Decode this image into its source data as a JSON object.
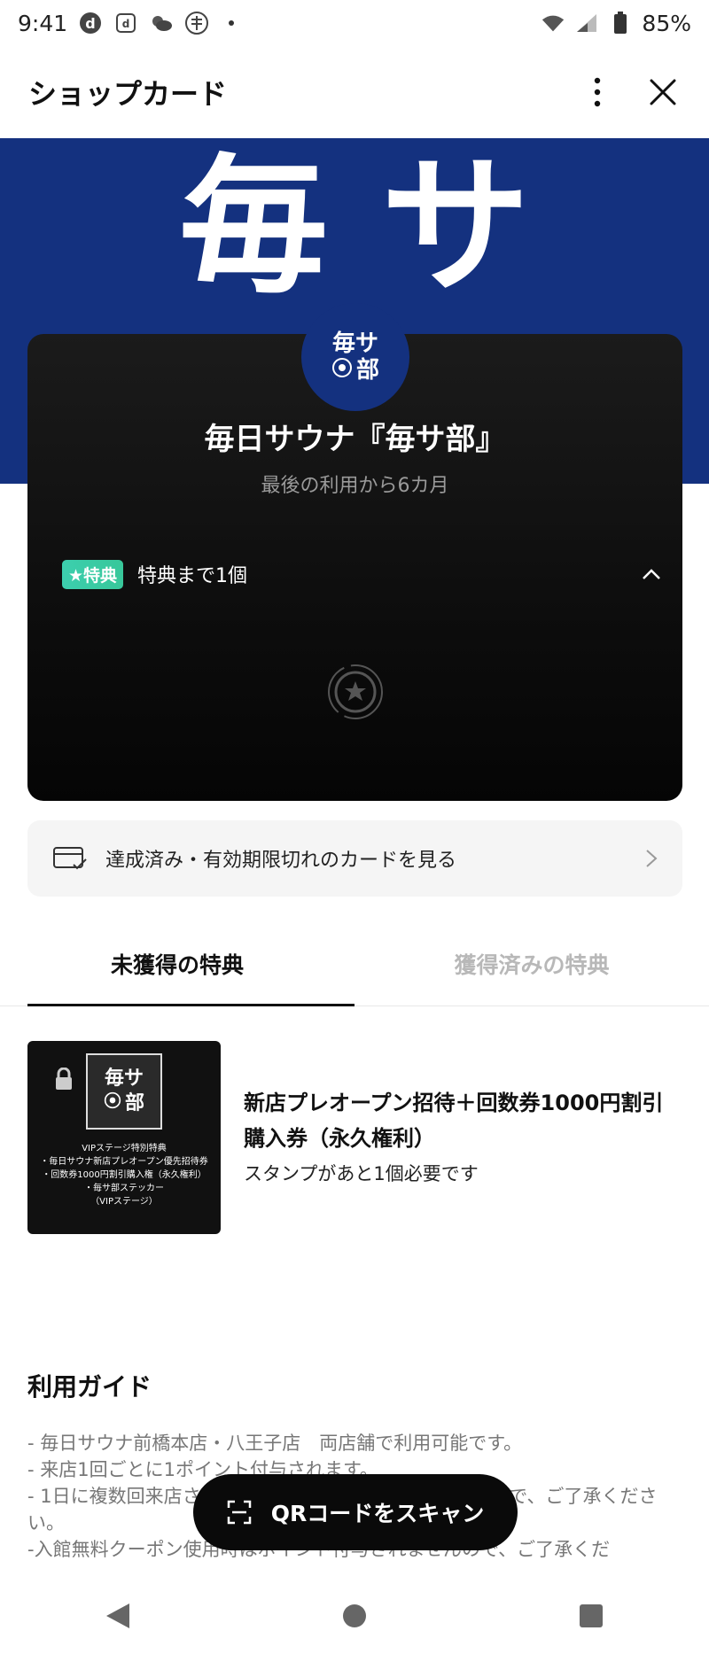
{
  "status_bar": {
    "time": "9:41",
    "battery": "85%"
  },
  "header": {
    "title": "ショップカード"
  },
  "banner": {
    "text": "毎サ"
  },
  "card": {
    "logo_top": "毎サ",
    "logo_bottom": "部",
    "title": "毎日サウナ『毎サ部』",
    "subtitle": "最後の利用から6カ月",
    "reward_badge": "★特典",
    "reward_text": "特典まで1個"
  },
  "history_link": {
    "label": "達成済み・有効期限切れのカードを見る"
  },
  "tabs": [
    {
      "label": "未獲得の特典",
      "active": true
    },
    {
      "label": "獲得済みの特典",
      "active": false
    }
  ],
  "reward_item": {
    "thumb_logo_top": "毎サ",
    "thumb_logo_bottom": "部",
    "thumb_lines": [
      "VIPステージ特別特典",
      "・毎日サウナ新店プレオープン優先招待券",
      "・回数券1000円割引購入権（永久権利）",
      "・毎サ部ステッカー",
      "（VIPステージ）"
    ],
    "title": "新店プレオープン招待＋回数券1000円割引購入券（永久権利）",
    "note": "スタンプがあと1個必要です"
  },
  "guide": {
    "title": "利用ガイド",
    "items": [
      "- 毎日サウナ前橋本店・八王子店　両店舗で利用可能です。",
      "- 来店1回ごとに1ポイント付与されます。",
      "- 1日に複数回来店されても1ポイントのみ付与されますので、ご了承ください。",
      "-入館無料クーポン使用時はポイント付与されませんので、ご了承くだ"
    ]
  },
  "scan_button": {
    "label": "QRコードをスキャン"
  },
  "colors": {
    "brand_blue": "#14317f",
    "badge_green": "#3ccfae"
  }
}
